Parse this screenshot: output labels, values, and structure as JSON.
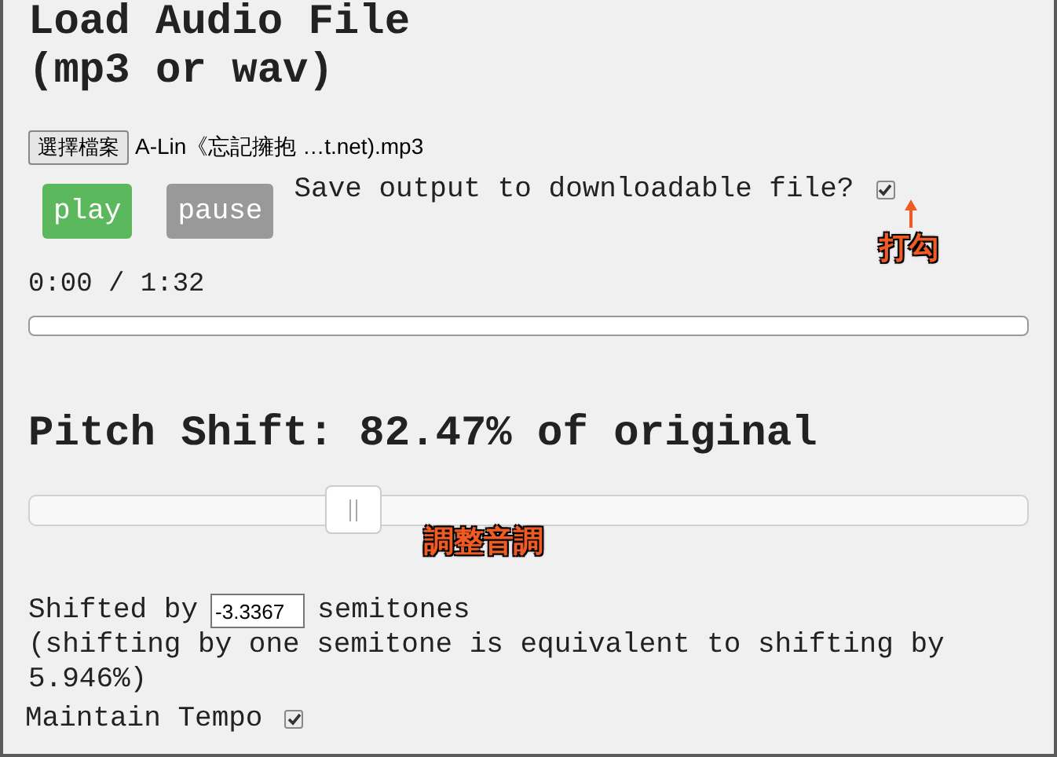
{
  "title": [
    "Load Audio File",
    "(mp3 or wav)"
  ],
  "file": {
    "button": "選擇檔案",
    "name": "A-Lin《忘記擁抱 …t.net).mp3"
  },
  "buttons": [
    {
      "label": "play",
      "kind": "play"
    },
    {
      "label": "pause",
      "kind": "pause"
    }
  ],
  "save_output": {
    "label": "Save output to downloadable file?",
    "checked": true,
    "annotation": "打勾"
  },
  "time": "0:00 / 1:32",
  "pitch": {
    "heading": "Pitch Shift: 82.47% of original",
    "level": 0.325,
    "annotation": "調整音調"
  },
  "shift": {
    "prefix": "Shifted by",
    "value": "-3.3367",
    "suffix": "semitones",
    "note": "(shifting by one semitone is equivalent to shifting by 5.946%)"
  },
  "maintain_tempo": {
    "label": "Maintain Tempo",
    "checked": true
  }
}
